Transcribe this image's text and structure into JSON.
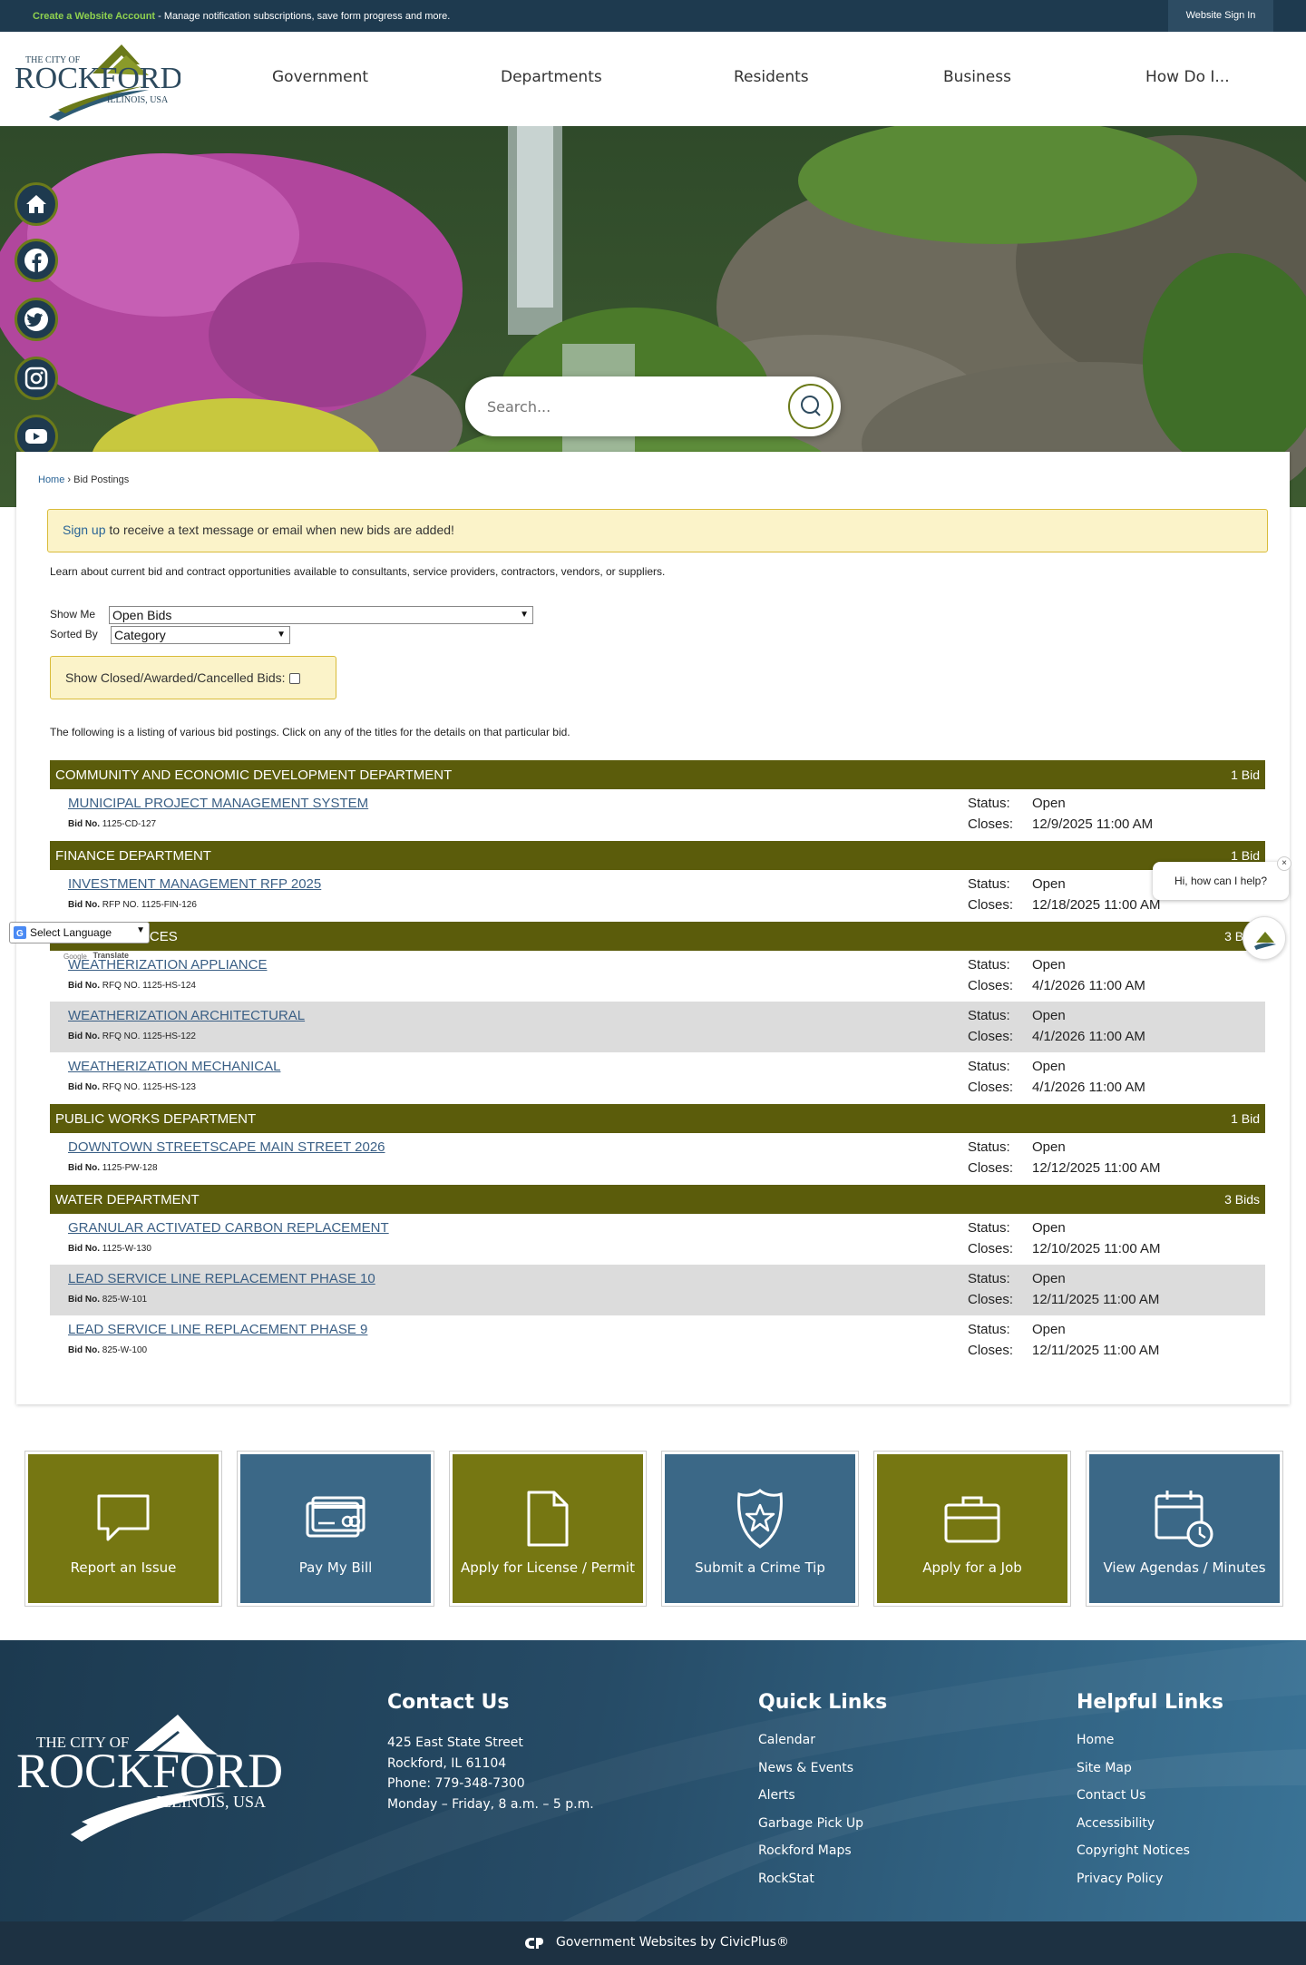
{
  "topbar": {
    "create_account": "Create a Website Account",
    "create_account_rest": " - Manage notification subscriptions, save form progress and more.",
    "sign_in": "Website Sign In"
  },
  "header": {
    "logo_text": "THE CITY OF ROCKFORD ILLINOIS, USA",
    "nav": [
      "Government",
      "Departments",
      "Residents",
      "Business",
      "How Do I..."
    ]
  },
  "search": {
    "placeholder": "Search..."
  },
  "breadcrumb": {
    "home": "Home",
    "current": "Bid Postings"
  },
  "alert": {
    "link": "Sign up",
    "text": " to receive a text message or email when new bids are added!"
  },
  "intro": "Learn about current bid and contract opportunities available to consultants, service providers, contractors, vendors, or suppliers.",
  "filters": {
    "show_me_label": "Show Me",
    "show_me_value": "Open Bids",
    "sorted_by_label": "Sorted By",
    "sorted_by_value": "Category",
    "closed_label": "Show Closed/Awarded/Cancelled Bids:"
  },
  "listing_note": "The following is a listing of various bid postings. Click on any of the titles for the details on that particular bid.",
  "labels": {
    "status": "Status:",
    "closes": "Closes:",
    "bid_no": "Bid No."
  },
  "departments": [
    {
      "name": "COMMUNITY AND ECONOMIC DEVELOPMENT DEPARTMENT",
      "count": "1 Bid",
      "bids": [
        {
          "title": "MUNICIPAL PROJECT MANAGEMENT SYSTEM",
          "no": "1125-CD-127",
          "status": "Open",
          "closes": "12/9/2025 11:00 AM"
        }
      ]
    },
    {
      "name": "FINANCE DEPARTMENT",
      "count": "1 Bid",
      "bids": [
        {
          "title": "INVESTMENT MANAGEMENT RFP 2025",
          "no": "RFP NO. 1125-FIN-126",
          "status": "Open",
          "closes": "12/18/2025 11:00 AM"
        }
      ]
    },
    {
      "name": "HUMAN SERVICES",
      "count": "3 Bids",
      "bids": [
        {
          "title": "WEATHERIZATION APPLIANCE",
          "no": "RFQ NO. 1125-HS-124",
          "status": "Open",
          "closes": "4/1/2026 11:00 AM"
        },
        {
          "title": "WEATHERIZATION ARCHITECTURAL",
          "no": "RFQ NO. 1125-HS-122",
          "status": "Open",
          "closes": "4/1/2026 11:00 AM"
        },
        {
          "title": "WEATHERIZATION MECHANICAL",
          "no": "RFQ NO. 1125-HS-123",
          "status": "Open",
          "closes": "4/1/2026 11:00 AM"
        }
      ]
    },
    {
      "name": "PUBLIC WORKS DEPARTMENT",
      "count": "1 Bid",
      "bids": [
        {
          "title": "DOWNTOWN STREETSCAPE MAIN STREET 2026",
          "no": "1125-PW-128",
          "status": "Open",
          "closes": "12/12/2025 11:00 AM"
        }
      ]
    },
    {
      "name": "WATER DEPARTMENT",
      "count": "3 Bids",
      "bids": [
        {
          "title": "GRANULAR ACTIVATED CARBON REPLACEMENT",
          "no": "1125-W-130",
          "status": "Open",
          "closes": "12/10/2025 11:00 AM"
        },
        {
          "title": "LEAD SERVICE LINE REPLACEMENT PHASE 10",
          "no": "825-W-101",
          "status": "Open",
          "closes": "12/11/2025 11:00 AM"
        },
        {
          "title": "LEAD SERVICE LINE REPLACEMENT PHASE 9",
          "no": "825-W-100",
          "status": "Open",
          "closes": "12/11/2025 11:00 AM"
        }
      ]
    }
  ],
  "tiles": [
    {
      "label": "Report an Issue",
      "icon": "chat-icon"
    },
    {
      "label": "Pay My Bill",
      "icon": "credit-card-icon"
    },
    {
      "label": "Apply for License / Permit",
      "icon": "document-icon"
    },
    {
      "label": "Submit a Crime Tip",
      "icon": "police-badge-icon"
    },
    {
      "label": "Apply for a Job",
      "icon": "briefcase-icon"
    },
    {
      "label": "View Agendas / Minutes",
      "icon": "calendar-clock-icon"
    }
  ],
  "footer": {
    "contact_title": "Contact Us",
    "address1": "425 East State Street",
    "address2": "Rockford, IL 61104",
    "phone": "Phone: 779-348-7300",
    "hours": "Monday – Friday, 8 a.m. – 5 p.m.",
    "quick_title": "Quick Links",
    "quick_links": [
      "Calendar",
      "News & Events",
      "Alerts",
      "Garbage Pick Up",
      "Rockford Maps",
      "RockStat"
    ],
    "helpful_title": "Helpful Links",
    "helpful_links": [
      "Home",
      "Site Map",
      "Contact Us",
      "Accessibility",
      "Copyright Notices",
      "Privacy Policy"
    ],
    "powered": "Government Websites by CivicPlus®"
  },
  "widgets": {
    "chat_greeting": "Hi, how can I help?",
    "language": "Select Language",
    "google_translate": "Translate"
  },
  "colors": {
    "navy": "#1e3a4f",
    "olive": "#5b5c0b",
    "tile_olive": "#767712",
    "tile_blue": "#3b6887",
    "alert_bg": "#fbf3c9"
  }
}
